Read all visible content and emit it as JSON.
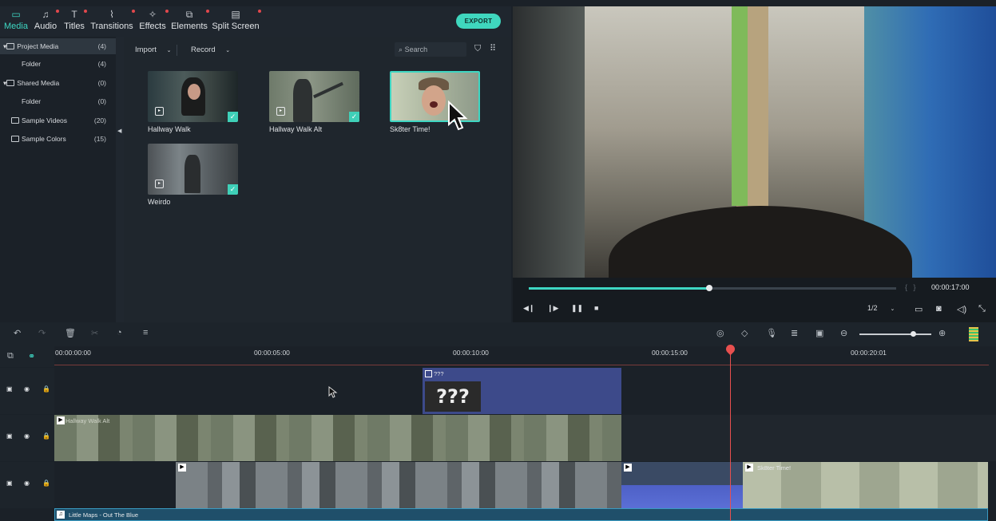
{
  "tabs": [
    {
      "label": "Media",
      "icon": "folder-icon",
      "active": true,
      "dot": false
    },
    {
      "label": "Audio",
      "icon": "music-note-icon",
      "active": false,
      "dot": true
    },
    {
      "label": "Titles",
      "icon": "text-icon",
      "active": false,
      "dot": true
    },
    {
      "label": "Transitions",
      "icon": "transitions-icon",
      "active": false,
      "dot": true
    },
    {
      "label": "Effects",
      "icon": "effects-icon",
      "active": false,
      "dot": true
    },
    {
      "label": "Elements",
      "icon": "elements-icon",
      "active": false,
      "dot": true
    },
    {
      "label": "Split Screen",
      "icon": "split-screen-icon",
      "active": false,
      "dot": true
    }
  ],
  "export_label": "EXPORT",
  "library": [
    {
      "name": "Project Media",
      "count": "(4)",
      "expanded": true
    },
    {
      "name": "Folder",
      "count": "(4)"
    },
    {
      "name": "Shared Media",
      "count": "(0)",
      "expanded": true
    },
    {
      "name": "Folder",
      "count": "(0)"
    },
    {
      "name": "Sample Videos",
      "count": "(20)"
    },
    {
      "name": "Sample Colors",
      "count": "(15)"
    }
  ],
  "media_toolbar": {
    "import_label": "Import",
    "record_label": "Record",
    "search_placeholder": "Search"
  },
  "media_items": [
    {
      "name": "Hallway Walk",
      "checked": true
    },
    {
      "name": "Hallway Walk Alt",
      "checked": true
    },
    {
      "name": "Sk8ter Time!",
      "checked": false,
      "selected": true
    },
    {
      "name": "Weirdo",
      "checked": true
    }
  ],
  "preview": {
    "timecode": "00:00:17:00",
    "quality": "1/2",
    "progress": 0.49
  },
  "ruler": [
    "00:00:00:00",
    "00:00:05:00",
    "00:00:10:00",
    "00:00:15:00",
    "00:00:20:01"
  ],
  "clips": {
    "title_clip": "???",
    "sk8ter_clip": "Sk8ter Time!",
    "audio_clip": "Little Maps - Out The Blue",
    "hallway_clip": "Hallway Walk Alt"
  },
  "colors": {
    "accent": "#3ed6c2",
    "playhead": "#e8504f",
    "title_clip": "#3d4a8a"
  }
}
